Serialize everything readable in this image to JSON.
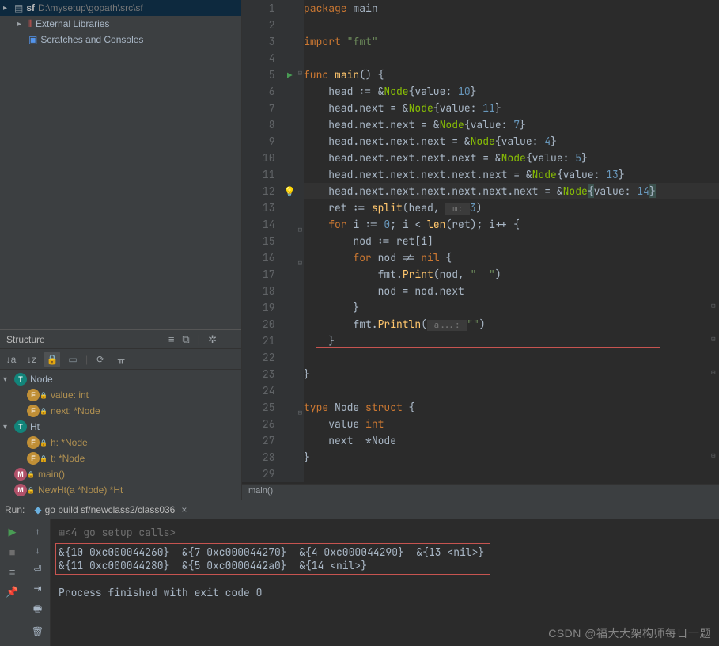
{
  "project": {
    "root_name": "sf",
    "root_path": "D:\\mysetup\\gopath\\src\\sf",
    "libs": "External Libraries",
    "scratches": "Scratches and Consoles"
  },
  "structure": {
    "title": "Structure",
    "items": [
      {
        "type": "t",
        "name": "Node",
        "children": [
          {
            "type": "f",
            "name": "value: int"
          },
          {
            "type": "f",
            "name": "next: *Node"
          }
        ]
      },
      {
        "type": "t",
        "name": "Ht",
        "children": [
          {
            "type": "f",
            "name": "h: *Node"
          },
          {
            "type": "f",
            "name": "t: *Node"
          }
        ]
      },
      {
        "type": "m",
        "name": "main()",
        "leaf": true
      },
      {
        "type": "m",
        "name": "NewHt(a *Node) *Ht",
        "leaf": true
      }
    ]
  },
  "code": {
    "lines": [
      {
        "n": 1,
        "html": "<span class='kw'>package</span> <span class='typ2'>main</span>"
      },
      {
        "n": 2,
        "html": ""
      },
      {
        "n": 3,
        "html": "<span class='kw'>import</span> <span class='str'>\"fmt\"</span>"
      },
      {
        "n": 4,
        "html": ""
      },
      {
        "n": 5,
        "gutter": "run",
        "fold": "open",
        "html": "<span class='kw'>func</span> <span class='fn'>main</span>() {"
      },
      {
        "n": 6,
        "html": "    head := &amp;<span class='typ'>Node</span>{value: <span class='num'>10</span>}"
      },
      {
        "n": 7,
        "html": "    head.next = &amp;<span class='typ'>Node</span>{value: <span class='num'>11</span>}"
      },
      {
        "n": 8,
        "html": "    head.next.next = &amp;<span class='typ'>Node</span>{value: <span class='num'>7</span>}"
      },
      {
        "n": 9,
        "html": "    head.next.next.next = &amp;<span class='typ'>Node</span>{value: <span class='num'>4</span>}"
      },
      {
        "n": 10,
        "html": "    head.next.next.next.next = &amp;<span class='typ'>Node</span>{value: <span class='num'>5</span>}"
      },
      {
        "n": 11,
        "html": "    head.next.next.next.next.next = &amp;<span class='typ'>Node</span>{value: <span class='num'>13</span>}"
      },
      {
        "n": 12,
        "cur": true,
        "gutter": "bulb",
        "html": "    head.next.next.next.next.next.next = &amp;<span class='typ'>Node</span><span class='brace-hl'>{</span>value: <span class='num'>14</span><span class='brace-hl'>}</span>"
      },
      {
        "n": 13,
        "html": "    ret := <span class='fn'>split</span>(head, <span class='hint'> m: </span><span class='num'>3</span>)"
      },
      {
        "n": 14,
        "fold": "open",
        "html": "    <span class='kw'>for</span> i := <span class='num'>0</span>; i &lt; <span class='fn'>len</span>(ret); i++ {"
      },
      {
        "n": 15,
        "html": "        nod := ret[i]"
      },
      {
        "n": 16,
        "fold": "open",
        "html": "        <span class='kw'>for</span> nod != <span class='kw'>nil</span> {"
      },
      {
        "n": 17,
        "html": "            fmt.<span class='fn'>Print</span>(nod, <span class='str'>\"  \"</span>)"
      },
      {
        "n": 18,
        "html": "            nod = nod.next"
      },
      {
        "n": 19,
        "html": "        }",
        "foldclose": true
      },
      {
        "n": 20,
        "html": "        fmt.<span class='fn'>Println</span>(<span class='hint'> a...: </span><span class='str'>\"\"</span>)"
      },
      {
        "n": 21,
        "html": "    }",
        "foldclose": true
      },
      {
        "n": 22,
        "html": ""
      },
      {
        "n": 23,
        "html": "}",
        "foldclose": true
      },
      {
        "n": 24,
        "html": ""
      },
      {
        "n": 25,
        "fold": "open",
        "html": "<span class='kw'>type</span> <span class='typ2'>Node</span> <span class='kw'>struct</span> {"
      },
      {
        "n": 26,
        "html": "    value <span class='kw'>int</span>"
      },
      {
        "n": 27,
        "html": "    next  *<span class='typ2'>Node</span>"
      },
      {
        "n": 28,
        "html": "}",
        "foldclose": true
      },
      {
        "n": 29,
        "html": ""
      }
    ],
    "crumb": "main()"
  },
  "run": {
    "label": "Run:",
    "config": "go build sf/newclass2/class036",
    "setup": "<4 go setup calls>",
    "lines": [
      "&{10 0xc000044260}  &{7 0xc000044270}  &{4 0xc000044290}  &{13 <nil>} ",
      "&{11 0xc000044280}  &{5 0xc0000442a0}  &{14 <nil>} ",
      "",
      "Process finished with exit code 0"
    ]
  },
  "watermark": "CSDN @福大大架构师每日一题"
}
